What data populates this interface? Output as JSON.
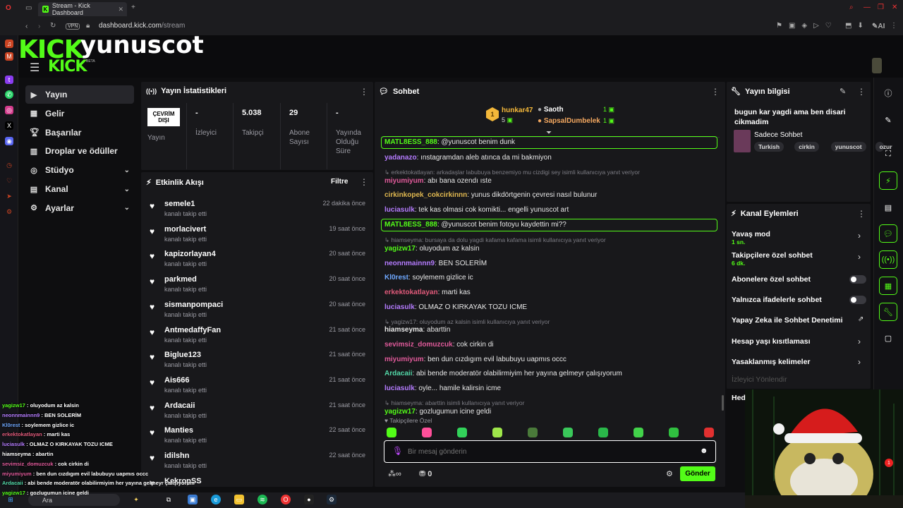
{
  "browser": {
    "tab_title": "Stream - Kick Dashboard",
    "url_domain": "dashboard.kick.com",
    "url_path": "/stream",
    "vpn": "VPN",
    "ai": "AI"
  },
  "header": {
    "logo": "KICK",
    "logo_small": "KICK",
    "beta": "BETA",
    "username": "yunuscot"
  },
  "nav": [
    {
      "label": "Yayın",
      "icon": "broadcast-icon",
      "active": true
    },
    {
      "label": "Gelir",
      "icon": "money-icon"
    },
    {
      "label": "Başarılar",
      "icon": "trophy-icon"
    },
    {
      "label": "Droplar ve ödüller",
      "icon": "gift-icon"
    },
    {
      "label": "Stüdyo",
      "icon": "studio-icon",
      "chevron": true
    },
    {
      "label": "Kanal",
      "icon": "channel-icon",
      "chevron": true
    },
    {
      "label": "Ayarlar",
      "icon": "gear-icon",
      "chevron": true
    }
  ],
  "stats": {
    "title": "Yayın İstatistikleri",
    "status_badge": "ÇEVRİM DIŞI",
    "status_label": "Yayın",
    "viewers_val": "-",
    "viewers_lbl": "İzleyici",
    "followers_val": "5.038",
    "followers_lbl": "Takipçi",
    "subs_val": "29",
    "subs_lbl": "Abone Sayısı",
    "uptime_val": "-",
    "uptime_lbl": "Yayında Olduğu Süre"
  },
  "activity": {
    "title": "Etkinlik Akışı",
    "filter": "Filtre",
    "items": [
      {
        "name": "semele1",
        "sub": "kanalı takip etti",
        "time": "22 dakika önce"
      },
      {
        "name": "morlacivert",
        "sub": "kanalı takip etti",
        "time": "19 saat önce"
      },
      {
        "name": "kapizorlayan4",
        "sub": "kanalı takip etti",
        "time": "20 saat önce"
      },
      {
        "name": "parkmed",
        "sub": "kanalı takip etti",
        "time": "20 saat önce"
      },
      {
        "name": "sismanpompaci",
        "sub": "kanalı takip etti",
        "time": "20 saat önce"
      },
      {
        "name": "AntmedaffyFan",
        "sub": "kanalı takip etti",
        "time": "21 saat önce"
      },
      {
        "name": "Biglue123",
        "sub": "kanalı takip etti",
        "time": "21 saat önce"
      },
      {
        "name": "Ais666",
        "sub": "kanalı takip etti",
        "time": "21 saat önce"
      },
      {
        "name": "Ardacaii",
        "sub": "kanalı takip etti",
        "time": "21 saat önce"
      },
      {
        "name": "Manties",
        "sub": "kanalı takip etti",
        "time": "22 saat önce"
      },
      {
        "name": "idilshn",
        "sub": "kanalı takip etti",
        "time": "22 saat önce"
      },
      {
        "name": "KekropSS",
        "sub": "",
        "time": ""
      }
    ]
  },
  "chat": {
    "title": "Sohbet",
    "leader1": {
      "name": "hunkar47",
      "count": "5",
      "rank": "1"
    },
    "leader2": {
      "name": "Saoth",
      "count": "1"
    },
    "leader3": {
      "name": "SapsalDumbelek",
      "count": "1"
    },
    "messages": [
      {
        "type": "hl",
        "user": "MATL8ESS_888",
        "text": ": @yunuscot benim dunk",
        "color": "#53fc18"
      },
      {
        "user": "yadanazo",
        "text": ": ınstagramdan aleb atınca da mi bakmiyon",
        "color": "#b57cff"
      },
      {
        "type": "reply",
        "text": "erkektokatlayan: arkadaşlar labubuya benzemiyo mu cizdigi sey isimli kullanıcıya yanıt veriyor"
      },
      {
        "user": "miyumiyum",
        "text": ": abı bana ozendı ıste",
        "color": "#e05a9a"
      },
      {
        "user": "cirkinkopek_cokcirkinnn",
        "text": ": yunus dikdörtgenin çevresi nasıl bulunur",
        "color": "#e0b850"
      },
      {
        "user": "luciasulk",
        "text": ": tek kas olmasi cok komikti... engelli yunuscot art",
        "color": "#b57cff"
      },
      {
        "type": "hl",
        "user": "MATL8ESS_888",
        "text": ": @yunuscot benim fotoyu kaydettin mi??",
        "color": "#53fc18"
      },
      {
        "type": "reply",
        "text": "hiamseyma: bursaya da dolu yagdi kafama kafama isimli kullanıcıya yanıt veriyor"
      },
      {
        "user": "yagizw17",
        "text": ": oluyodum az kalsin",
        "color": "#53fc18"
      },
      {
        "user": "neonnmainnn9",
        "text": ": BEN SOLERİM",
        "color": "#b57cff"
      },
      {
        "user": "Kl0rest",
        "text": ": soylemem gizlice ic",
        "color": "#6fa8ff"
      },
      {
        "user": "erkektokatlayan",
        "text": ": marti kas",
        "color": "#e05a7a"
      },
      {
        "user": "luciasulk",
        "text": ": OLMAZ O KIRKAYAK TOZU ICME",
        "color": "#b57cff"
      },
      {
        "type": "reply",
        "text": "yagizw17: oluyodum az kalsin isimli kullanıcıya yanıt veriyor"
      },
      {
        "user": "hiamseyma",
        "text": ": abarttin",
        "color": "#e8e8e8"
      },
      {
        "user": "sevimsiz_domuzcuk",
        "text": ": cok cirkin di",
        "color": "#e05a9a"
      },
      {
        "user": "miyumiyum",
        "text": ": ben dun cızdıgım evil labubuyu uapmıs occc",
        "color": "#e05a9a"
      },
      {
        "user": "Ardacaii",
        "text": ": abi bende moderatör olabilirmiyim her yayına gelmeyr çalışıyorum",
        "color": "#53d8a8"
      },
      {
        "user": "luciasulk",
        "text": ": oyle... hamile kalirsin icme",
        "color": "#b57cff"
      },
      {
        "type": "reply",
        "text": "hiamseyma: abarttin isimli kullanıcıya yanıt veriyor"
      },
      {
        "user": "yagizw17",
        "text": ": gozlugumun icine geldi",
        "color": "#53fc18"
      }
    ],
    "followers_only": "Takipçilere Özel",
    "input_placeholder": "Bir mesaj gönderin",
    "points": "0",
    "send": "Gönder"
  },
  "info": {
    "title": "Yayın bilgisi",
    "stream_title": "bugun kar yagdi ama ben disari cikmadim",
    "category": "Sadece Sohbet",
    "tags": [
      "Turkish",
      "cirkin",
      "yunuscot",
      "ozur"
    ]
  },
  "actions": {
    "title": "Kanal Eylemleri",
    "rows": [
      {
        "label": "Yavaş mod",
        "sub": "1 sn.",
        "kind": "arrow"
      },
      {
        "label": "Takipçilere özel sohbet",
        "sub": "6 dk.",
        "kind": "arrow"
      },
      {
        "label": "Abonelere özel sohbet",
        "kind": "toggle"
      },
      {
        "label": "Yalnızca ifadelerle sohbet",
        "kind": "toggle"
      },
      {
        "label": "Yapay Zeka ile Sohbet Denetimi",
        "kind": "external"
      },
      {
        "label": "Hesap yaşı kısıtlaması",
        "kind": "arrow"
      },
      {
        "label": "Yasaklanmış kelimeler",
        "kind": "arrow"
      },
      {
        "label": "İzleyici Yönlendir",
        "kind": "none"
      },
      {
        "label": "Hed",
        "kind": "none"
      }
    ]
  },
  "overlay": [
    {
      "user": "yagizw17",
      "text": " : oluyodum az kalsin",
      "color": "#53fc18"
    },
    {
      "user": "neonnmainnn9",
      "text": " : BEN SOLERİM",
      "color": "#b57cff"
    },
    {
      "user": "Kl0rest",
      "text": " : soylemem gizlice ic",
      "color": "#6fa8ff"
    },
    {
      "user": "erkektokatlayan",
      "text": " : marti kas",
      "color": "#e05a7a"
    },
    {
      "user": "luciasulk",
      "text": " : OLMAZ O KIRKAYAK TOZU ICME",
      "color": "#b57cff"
    },
    {
      "user": "hiamseyma",
      "text": " : abartin",
      "color": "#fff"
    },
    {
      "user": "sevimsiz_domuzcuk",
      "text": " : cok cirkin di",
      "color": "#e05a9a"
    },
    {
      "user": "miyumiyum",
      "text": " : ben dun cızdıgım evil labubuyu uapmıs occc",
      "color": "#e05a9a"
    },
    {
      "user": "Ardacaii",
      "text": " : abi bende moderatör olabilirmiyim her yayına gelmeyr çalışıyorum",
      "color": "#53d8a8"
    },
    {
      "user": "yagizw17",
      "text": " : gozlugumun icine geldi",
      "color": "#53fc18"
    }
  ],
  "taskbar": {
    "search": "Ara"
  }
}
